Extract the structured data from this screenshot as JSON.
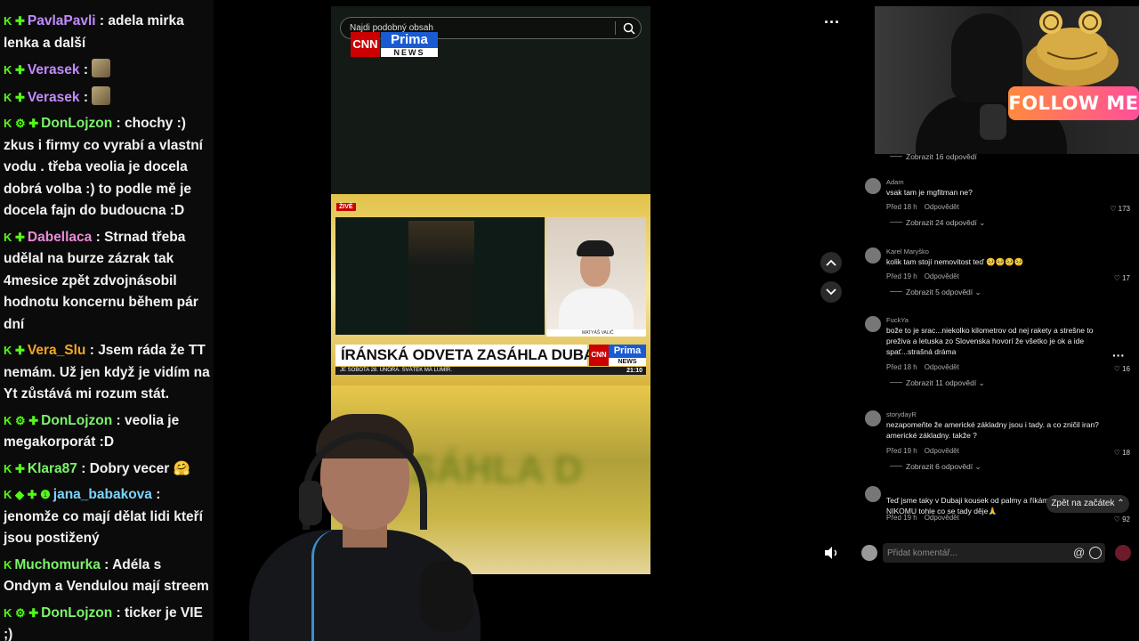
{
  "chat": {
    "messages": [
      {
        "badges": "K ✚",
        "user": "PavlaPavli",
        "color": "#c28bff",
        "text": "adela mirka lenka a další",
        "emote": false
      },
      {
        "badges": "K ✚",
        "user": "Verasek",
        "color": "#c28bff",
        "text": "",
        "emote": true
      },
      {
        "badges": "K ✚",
        "user": "Verasek",
        "color": "#c28bff",
        "text": "",
        "emote": true
      },
      {
        "badges": "K ⚙ ✚",
        "user": "DonLojzon",
        "color": "#7cf36a",
        "text": "chochy :) zkus i firmy co vyrabí a vlastní vodu . třeba veolia je docela dobrá volba :) to podle mě je docela fajn do budoucna :D",
        "emote": false
      },
      {
        "badges": "K ✚",
        "user": "Dabellaca",
        "color": "#e98bd6",
        "text": "Strnad třeba udělal na burze zázrak tak 4mesice zpět zdvojnásobil hodnotu koncernu během pár dní",
        "emote": false
      },
      {
        "badges": "K ✚",
        "user": "Vera_Slu",
        "color": "#f5a623",
        "text": "Jsem ráda že TT nemám. Už jen když je vidím na Yt zůstává mi rozum stát.",
        "emote": false
      },
      {
        "badges": "K ⚙ ✚",
        "user": "DonLojzon",
        "color": "#7cf36a",
        "text": "veolia je megakorporát :D",
        "emote": false
      },
      {
        "badges": "K ✚",
        "user": "Klara87",
        "color": "#7cf36a",
        "text": "Dobry vecer 🤗",
        "emote": false
      },
      {
        "badges": "K ◆ ✚ ❶",
        "user": "jana_babakova",
        "color": "#7cd4ff",
        "text": "jenomže co mají dělat lidi kteří jsou postižený",
        "emote": false
      },
      {
        "badges": "K",
        "user": "Muchomurka",
        "color": "#7cf36a",
        "text": "Adéla s Ondym a Vendulou mají streem",
        "emote": false
      },
      {
        "badges": "K ⚙ ✚",
        "user": "DonLojzon",
        "color": "#7cf36a",
        "text": "ticker je VIE ;)",
        "emote": false
      }
    ]
  },
  "player": {
    "search_placeholder": "Najdi podobný obsah",
    "logo_cnn": "CNN",
    "logo_prima": "Prima",
    "logo_news": "NEWS",
    "live_label": "ŽIVĚ",
    "guest_name": "MATYÁŠ VALIČ",
    "headline": "ÍRÁNSKÁ ODVETA ZASÁHLA DUBAJ",
    "ticker_text": "JE SOBOTA 28. ÚNORA. SVÁTEK MÁ LUMÍR.",
    "ticker_time": "21:10",
    "blurred_text": "ZASÁHLA D"
  },
  "webcam": {
    "follow_label": "FOLLOW ME"
  },
  "comments": {
    "first_show_replies": "Zobrazit 16 odpovědí",
    "reply_label": "Odpovědět",
    "items": [
      {
        "user": "Adam",
        "text": "vsak tam je mgfitman ne?",
        "time": "Před 18 h",
        "likes": "173",
        "show_replies": "Zobrazit 24 odpovědí"
      },
      {
        "user": "Karel Maryško",
        "text": "kolik tam stojí nemovitost teď 🥺🥺🥺🥺",
        "time": "Před 19 h",
        "likes": "17",
        "show_replies": "Zobrazit 5 odpovědí"
      },
      {
        "user": "FuckYa",
        "text": "bože to je srac...niekolko kilometrov od nej rakety a strešne to preživa a letuska zo Slovenska hovorí že všetko je ok a ide spať...strašná dráma",
        "time": "Před 18 h",
        "likes": "16",
        "show_replies": "Zobrazit 11 odpovědí"
      },
      {
        "user": "storydayR",
        "text": "nezapomeňte že americké základny jsou i tady. a co zničil iran? americké základny. takže ?",
        "time": "Před 19 h",
        "likes": "18",
        "show_replies": "Zobrazit 6 odpovědí"
      },
      {
        "user": "",
        "text": "Teď jsme taky v Dubaji kousek od palmy a říkám, nepřál bych NIKOMU tohle co se tady děje🙏",
        "time": "Před 19 h",
        "likes": "92",
        "show_replies": ""
      }
    ],
    "back_to_top": "Zpět na začátek",
    "input_placeholder": "Přidat komentář...",
    "at_symbol": "@"
  },
  "colors": {
    "accent_green": "#53fc18",
    "follow_gradient_start": "#ff8a3d",
    "follow_gradient_end": "#ff4f9a",
    "cnn_red": "#cc0000",
    "prima_blue": "#1a5bd4"
  }
}
